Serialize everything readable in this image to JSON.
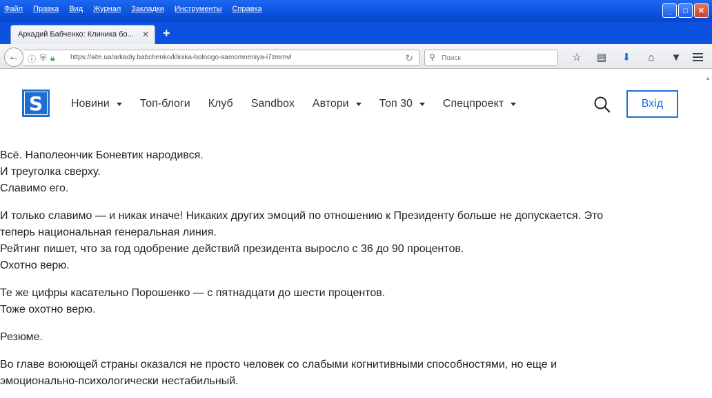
{
  "menubar": {
    "items": [
      "Файл",
      "Правка",
      "Вид",
      "Журнал",
      "Закладки",
      "Инструменты",
      "Справка"
    ]
  },
  "window": {
    "minimize": "_",
    "maximize": "□",
    "close": "✕"
  },
  "tab": {
    "title": "Аркадий Бабченко: Клиника бо...",
    "close": "✕",
    "new_tab": "+"
  },
  "navbar": {
    "url": "https://site.ua/arkadiy.babchenko/klinika-bolnogo-samomneniya-i7zmmvl",
    "search_placeholder": "Поиск",
    "icons": [
      "star-icon",
      "reading-list-icon",
      "download-icon",
      "home-icon",
      "pocket-icon"
    ]
  },
  "site": {
    "logo": "S",
    "nav": [
      {
        "label": "Новини",
        "dropdown": true
      },
      {
        "label": "Топ-блоги",
        "dropdown": false
      },
      {
        "label": "Клуб",
        "dropdown": false
      },
      {
        "label": "Sandbox",
        "dropdown": false
      },
      {
        "label": "Автори",
        "dropdown": true
      },
      {
        "label": "Топ 30",
        "dropdown": true
      },
      {
        "label": "Спецпроект",
        "dropdown": true
      }
    ],
    "login": "Вхід",
    "accent_color": "#1f6fd1"
  },
  "article": {
    "paragraphs": [
      [
        "Всё. Наполеончик Боневтик народився.",
        "И треуголка сверху.",
        "Славимо его."
      ],
      [
        "И только славимо — и никак иначе! Никаких других эмоций по отношению к Президенту больше не допускается. Это",
        "теперь национальная генеральная линия.",
        "Рейтинг пишет, что за год одобрение действий президента выросло с 36 до 90 процентов.",
        "Охотно верю."
      ],
      [
        "Те же цифры касательно Порошенко — с пятнадцати до шести процентов.",
        "Тоже охотно верю."
      ],
      [
        "Резюме."
      ],
      [
        "Во главе воюющей страны оказался не просто человек со слабыми когнитивными способностями, но еще и",
        "эмоционально-психологически нестабильный."
      ]
    ]
  }
}
